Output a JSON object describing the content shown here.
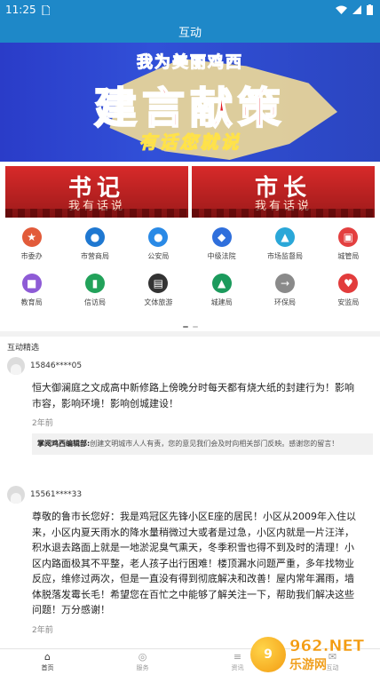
{
  "status_bar": {
    "time": "11:25",
    "icons": [
      "sim-icon",
      "wifi-icon",
      "signal-icon",
      "battery-icon"
    ]
  },
  "title": "互动",
  "banner": {
    "tagline": "我为美丽鸡西",
    "headline": "建言献策",
    "subline": "有话您就说"
  },
  "cards": [
    {
      "title": "书记",
      "subtitle": "我有话说"
    },
    {
      "title": "市长",
      "subtitle": "我有话说"
    }
  ],
  "departments": [
    {
      "label": "市委办",
      "icon": "flag-icon",
      "glyph": "★",
      "color": "#e25b3a"
    },
    {
      "label": "市营商局",
      "icon": "shield-icon",
      "glyph": "●",
      "color": "#1f78d1"
    },
    {
      "label": "公安局",
      "icon": "police-icon",
      "glyph": "●",
      "color": "#2a8ae6"
    },
    {
      "label": "中级法院",
      "icon": "court-icon",
      "glyph": "◆",
      "color": "#2f6fdc"
    },
    {
      "label": "市场监督局",
      "icon": "flask-icon",
      "glyph": "▲",
      "color": "#2aa7d8"
    },
    {
      "label": "城管局",
      "icon": "basket-icon",
      "glyph": "▣",
      "color": "#e34040"
    },
    {
      "label": "教育局",
      "icon": "book-icon",
      "glyph": "■",
      "color": "#8e5bd6"
    },
    {
      "label": "信访局",
      "icon": "phone-icon",
      "glyph": "▮",
      "color": "#22a25a"
    },
    {
      "label": "文体旅游",
      "icon": "film-icon",
      "glyph": "▤",
      "color": "#333333"
    },
    {
      "label": "城建局",
      "icon": "building-icon",
      "glyph": "▲",
      "color": "#1b9a5c"
    },
    {
      "label": "环保局",
      "icon": "arrow-right-icon",
      "glyph": "→",
      "color": "#8a8a8a"
    },
    {
      "label": "安监局",
      "icon": "heart-icon",
      "glyph": "♥",
      "color": "#e23c3c"
    }
  ],
  "section_title": "互动精选",
  "posts": [
    {
      "user": "15846****05",
      "content": "恒大御澜庭之文成高中新修路上傍晚分时每天都有烧大纸的封建行为！影响市容，影响环境！影响创城建设！",
      "time": "2年前",
      "reply_author": "掌阅鸡西编辑部:",
      "reply_text": "创建文明城市人人有责，您的意见我们会及时向相关部门反映。感谢您的留言！"
    },
    {
      "user": "15561****33",
      "content": "尊敬的鲁市长您好：我是鸡冠区先锋小区E座的居民！小区从2009年入住以来，小区内夏天雨水的降水量稍微过大或者是过急，小区内就是一片汪洋，积水退去路面上就是一地淤泥臭气熏天，冬季积雪也得不到及时的清理！小区内路面极其不平整，老人孩子出行困难！楼顶漏水问题严重，多年找物业反应，维修过两次，但是一直没有得到彻底解决和改善！屋内常年漏雨，墙体脱落发霉长毛！希望您在百忙之中能够了解关注一下，帮助我们解决这些问题！万分感谢！",
      "time": "2年前"
    }
  ],
  "tabs": [
    {
      "label": "首页",
      "icon": "home-icon",
      "glyph": "⌂"
    },
    {
      "label": "服务",
      "icon": "compass-icon",
      "glyph": "◎"
    },
    {
      "label": "资讯",
      "icon": "list-icon",
      "glyph": "≡"
    },
    {
      "label": "互动",
      "icon": "chat-icon",
      "glyph": "✉"
    }
  ],
  "watermark": {
    "badge": "9",
    "top": "962.NET",
    "bottom": "乐游网"
  }
}
